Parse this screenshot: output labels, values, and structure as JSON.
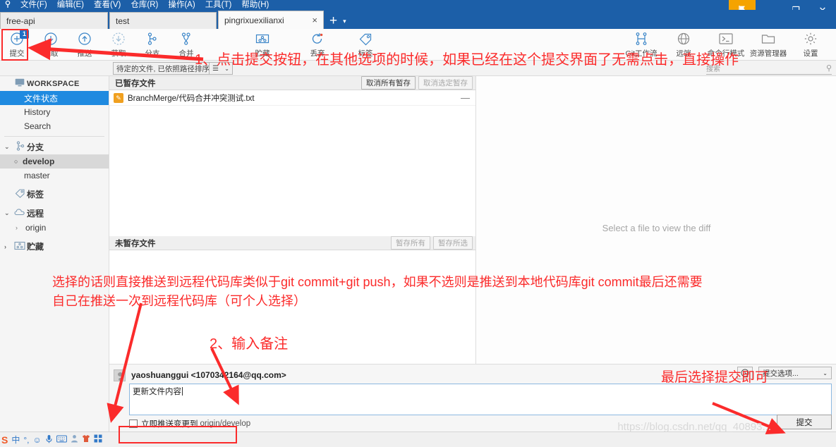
{
  "window": {
    "menu_items": [
      "文件(F)",
      "编辑(E)",
      "查看(V)",
      "仓库(R)",
      "操作(A)",
      "工具(T)",
      "帮助(H)"
    ],
    "logo_icon": "sourcetree-logo-icon",
    "flag_icon": "flag-icon",
    "minimize_icon": "minimize-icon",
    "restore_icon": "restore-icon",
    "close_icon": "close-icon",
    "hamburger_icon": "hamburger-menu-icon"
  },
  "tabs": [
    {
      "label": "free-api",
      "active": false,
      "closable": false
    },
    {
      "label": "test",
      "active": false,
      "closable": false
    },
    {
      "label": "pingrixuexilianxi",
      "active": true,
      "closable": true,
      "close_glyph": "×"
    }
  ],
  "tabbar": {
    "new_tab_glyph": "+",
    "dropdown_glyph": "▾"
  },
  "ribbon": {
    "left_buttons": [
      {
        "label": "提交",
        "icon": "commit-icon",
        "badge": "1"
      },
      {
        "label": "拉取",
        "icon": "pull-down-icon",
        "badge": ""
      },
      {
        "label": "推送",
        "icon": "push-up-icon",
        "badge": ""
      },
      {
        "label": "获取",
        "icon": "fetch-icon",
        "badge": ""
      },
      {
        "label": "分支",
        "icon": "branch-icon",
        "badge": ""
      },
      {
        "label": "合并",
        "icon": "merge-icon",
        "badge": ""
      },
      {
        "label": "贮藏",
        "icon": "stash-icon",
        "badge": ""
      },
      {
        "label": "丢弃",
        "icon": "discard-icon",
        "badge": ""
      },
      {
        "label": "标签",
        "icon": "tag-icon",
        "badge": ""
      }
    ],
    "right_buttons": [
      {
        "label": "Git工作流",
        "icon": "gitflow-icon"
      },
      {
        "label": "远端",
        "icon": "globe-icon"
      },
      {
        "label": "命令行模式",
        "icon": "terminal-icon"
      },
      {
        "label": "资源管理器",
        "icon": "folder-icon"
      },
      {
        "label": "设置",
        "icon": "gear-icon"
      }
    ]
  },
  "subbar": {
    "sort_label": "待定的文件, 已依照路径排序",
    "sort_chevron": "⌄",
    "list_mode_icon": "list-view-icon",
    "list_mode_chevron": "⌄",
    "search_placeholder": "搜索",
    "search_icon": "search-icon"
  },
  "sidebar": {
    "workspace": {
      "label": "WORKSPACE",
      "icon": "monitor-icon",
      "items": [
        {
          "label": "文件状态",
          "selected": true
        },
        {
          "label": "History",
          "selected": false
        },
        {
          "label": "Search",
          "selected": false
        }
      ]
    },
    "branches": {
      "label": "分支",
      "icon": "branch-icon",
      "twisty": "⌄",
      "items": [
        {
          "label": "develop",
          "current": true,
          "bullet": "○"
        },
        {
          "label": "master",
          "current": false,
          "bullet": ""
        }
      ]
    },
    "tags": {
      "label": "标签",
      "icon": "tag-icon",
      "twisty": ""
    },
    "remotes": {
      "label": "远程",
      "icon": "cloud-icon",
      "twisty": "⌄",
      "items": [
        {
          "label": "origin",
          "twisty": "›"
        }
      ]
    },
    "stashes": {
      "label": "贮藏",
      "icon": "stash-icon",
      "twisty": "›"
    }
  },
  "file_panel": {
    "staged": {
      "title": "已暂存文件",
      "unstage_all_label": "取消所有暂存",
      "unstage_selected_label": "取消选定暂存",
      "unstage_selected_disabled": true,
      "files": [
        {
          "name": "BranchMerge/代码合并冲突测试.txt",
          "status_icon": "modified-file-icon",
          "status_glyph": "✎",
          "remove_glyph": "—"
        }
      ]
    },
    "unstaged": {
      "title": "未暂存文件",
      "stage_all_label": "暂存所有",
      "stage_selected_label": "暂存所选",
      "stage_all_disabled": true,
      "stage_selected_disabled": true,
      "files": []
    }
  },
  "diff_panel": {
    "empty_message": "Select a file to view the diff"
  },
  "commit": {
    "author": "yaoshuanggui <1070342164@qq.com>",
    "avatar_icon": "user-avatar-icon",
    "history_icon": "clock-icon",
    "options_label": "提交选项...",
    "options_chevron": "⌄",
    "message_value": "更新文件内容",
    "push_checkbox_checked": false,
    "push_label_main": "立即推送变更到",
    "push_label_target": "origin/develop",
    "commit_button_label": "提交"
  },
  "taskbar": {
    "ime_logo": "sogou-ime-icon",
    "items": [
      {
        "icon": "chinese-mode-icon",
        "glyph": "中"
      },
      {
        "icon": "punctuation-icon",
        "glyph": "°,"
      },
      {
        "icon": "emoji-icon",
        "glyph": "☺"
      },
      {
        "icon": "microphone-icon",
        "glyph": "🎤"
      },
      {
        "icon": "keyboard-icon",
        "glyph": "⌨"
      },
      {
        "icon": "user-icon",
        "glyph": "👤"
      },
      {
        "icon": "skin-icon",
        "glyph": "👕"
      },
      {
        "icon": "toolbox-icon",
        "glyph": "▦"
      }
    ]
  },
  "annotations": {
    "step1": "1、点击提交按钮，在其他选项的时候，如果已经在这个提交界面了无需点击，直接操作",
    "push_note_line1": "选择的话则直接推送到远程代码库类似于git commit+git push，如果不选则是推送到本地代码库git commit最后还需要",
    "push_note_line2": "自己在推送一次到远程代码库（可个人选择）",
    "step2": "2、输入备注",
    "step3": "最后选择提交即可",
    "watermark": "https://blog.csdn.net/qq_40893..."
  }
}
